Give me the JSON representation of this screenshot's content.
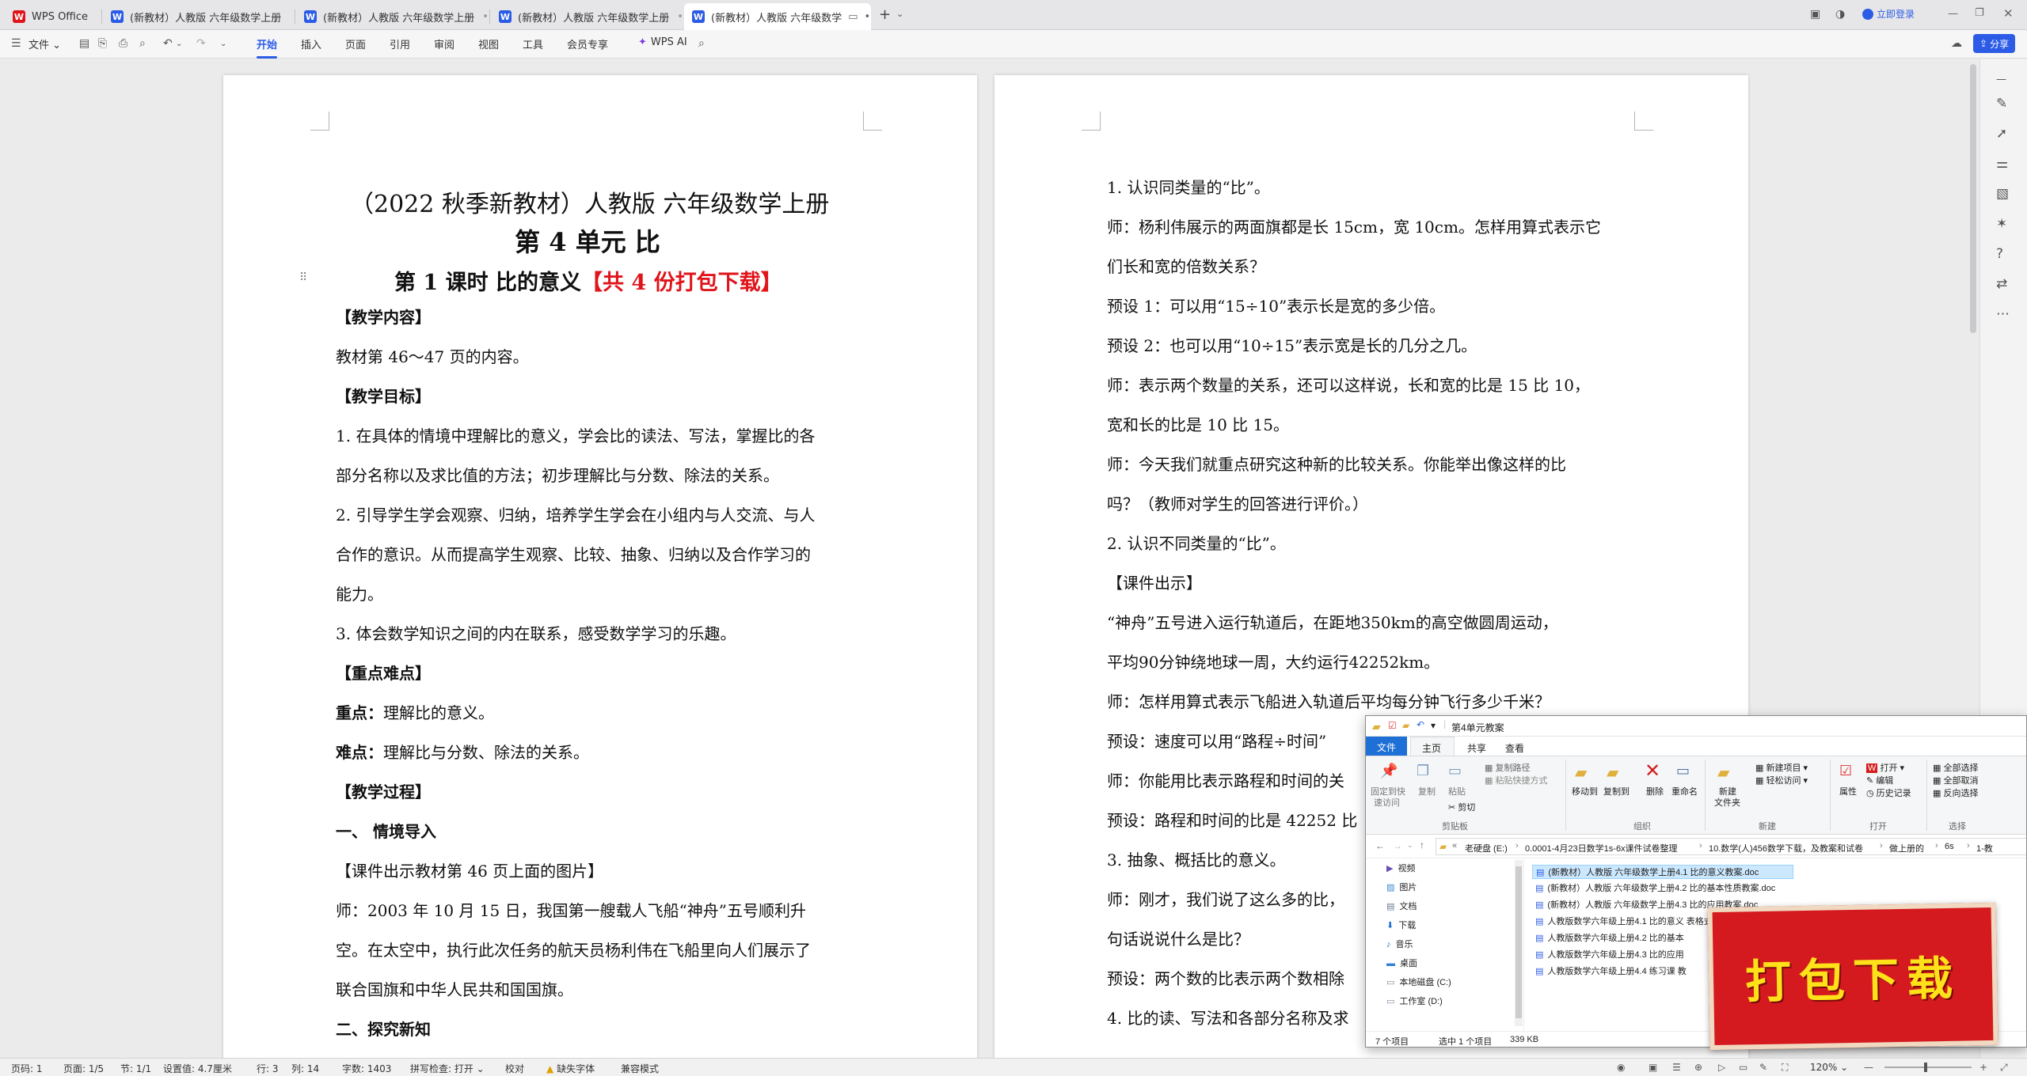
{
  "app": {
    "brand": "WPS Office",
    "accent": "#2c5ce6",
    "brand_color": "#e0141b"
  },
  "tabs": [
    {
      "label": "(新教材）人教版 六年级数学上册"
    },
    {
      "label": "(新教材）人教版 六年级数学上册"
    },
    {
      "label": "(新教材）人教版 六年级数学上册"
    },
    {
      "label": "(新教材）人教版 六年级数学"
    }
  ],
  "titlebar": {
    "login": "立即登录"
  },
  "menu": {
    "file": "文件",
    "items": [
      "开始",
      "插入",
      "页面",
      "引用",
      "审阅",
      "视图",
      "工具",
      "会员专享"
    ],
    "ai": "WPS AI",
    "share": "分享"
  },
  "page1": {
    "title_line1": "（2022 秋季新教材）人教版  六年级数学上册",
    "title_line2": "第 4 单元  比",
    "subtitle": "第 1 课时    比的意义",
    "subtitle_red": "【共 4 份打包下载】",
    "lines": [
      {
        "text": "【教学内容】",
        "bold": true
      },
      {
        "text": "教材第 46～47 页的内容。",
        "bold": false
      },
      {
        "text": "【教学目标】",
        "bold": true
      },
      {
        "text": "1. 在具体的情境中理解比的意义，学会比的读法、写法，掌握比的各",
        "bold": false
      },
      {
        "text": "部分名称以及求比值的方法；初步理解比与分数、除法的关系。",
        "bold": false
      },
      {
        "text": "2. 引导学生学会观察、归纳，培养学生学会在小组内与人交流、与人",
        "bold": false
      },
      {
        "text": "合作的意识。从而提高学生观察、比较、抽象、归纳以及合作学习的",
        "bold": false
      },
      {
        "text": "能力。",
        "bold": false
      },
      {
        "text": "3. 体会数学知识之间的内在联系，感受数学学习的乐趣。",
        "bold": false
      },
      {
        "text": "【重点难点】",
        "bold": true
      },
      {
        "text": "理解比的意义。",
        "bold": false,
        "lead": "重点："
      },
      {
        "text": "理解比与分数、除法的关系。",
        "bold": false,
        "lead": "难点："
      },
      {
        "text": "【教学过程】",
        "bold": true
      },
      {
        "text": "一、  情境导入",
        "bold": true
      },
      {
        "text": "【课件出示教材第 46 页上面的图片】",
        "bold": false
      },
      {
        "text": "师：2003 年 10 月 15 日，我国第一艘载人飞船“神舟”五号顺利升",
        "bold": false
      },
      {
        "text": "空。在太空中，执行此次任务的航天员杨利伟在飞船里向人们展示了",
        "bold": false
      },
      {
        "text": "联合国旗和中华人民共和国国旗。",
        "bold": false
      },
      {
        "text": "二、探究新知",
        "bold": true
      }
    ]
  },
  "page2": {
    "lines": [
      {
        "text": "1. 认识同类量的“比”。",
        "bold": false
      },
      {
        "text": "师：杨利伟展示的两面旗都是长 15cm，宽 10cm。怎样用算式表示它",
        "bold": false
      },
      {
        "text": "们长和宽的倍数关系？",
        "bold": false
      },
      {
        "text": "预设 1：可以用“15÷10”表示长是宽的多少倍。",
        "bold": false
      },
      {
        "text": "预设 2：也可以用“10÷15”表示宽是长的几分之几。",
        "bold": false
      },
      {
        "text": "师：表示两个数量的关系，还可以这样说，长和宽的比是 15 比 10，",
        "bold": false
      },
      {
        "text": "宽和长的比是 10 比 15。",
        "bold": false
      },
      {
        "text": "师：今天我们就重点研究这种新的比较关系。你能举出像这样的比",
        "bold": false
      },
      {
        "text": "吗？（教师对学生的回答进行评价。）",
        "bold": false
      },
      {
        "text": "2. 认识不同类量的“比”。",
        "bold": false
      },
      {
        "text": "【课件出示】",
        "bold": false
      },
      {
        "text": "    “神舟”五号进入运行轨道后，在距地350km的高空做圆周运动，",
        "bold": false
      },
      {
        "text": " 平均90分钟绕地球一周，大约运行42252km。",
        "bold": false
      },
      {
        "text": "师：怎样用算式表示飞船进入轨道后平均每分钟飞行多少千米？",
        "bold": false
      },
      {
        "text": "预设：速度可以用“路程÷时间”",
        "bold": false
      },
      {
        "text": "师：你能用比表示路程和时间的关",
        "bold": false
      },
      {
        "text": "预设：路程和时间的比是 42252 比",
        "bold": false
      },
      {
        "text": "3. 抽象、概括比的意义。",
        "bold": false
      },
      {
        "text": "师：刚才，我们说了这么多的比，",
        "bold": false
      },
      {
        "text": "句话说说什么是比？",
        "bold": false
      },
      {
        "text": "预设：两个数的比表示两个数相除",
        "bold": false
      },
      {
        "text": "4. 比的读、写法和各部分名称及求",
        "bold": false
      }
    ]
  },
  "explorer": {
    "title": "第4单元教案",
    "ribbon_tabs": [
      "文件",
      "主页",
      "共享",
      "查看"
    ],
    "clipboard": {
      "pin": "固定到快",
      "pin2": "速访问",
      "copy": "复制",
      "paste": "粘贴",
      "copy_path": "复制路径",
      "paste_shortcut": "粘贴快捷方式",
      "cut": "剪切",
      "group": "剪贴板"
    },
    "organize": {
      "move": "移动到",
      "copyto": "复制到",
      "delete": "删除",
      "rename": "重命名",
      "group": "组织"
    },
    "new": {
      "folder": "新建",
      "folder2": "文件夹",
      "item": "新建项目",
      "easy": "轻松访问",
      "group": "新建"
    },
    "open": {
      "props": "属性",
      "open": "打开",
      "edit": "编辑",
      "history": "历史记录",
      "group": "打开"
    },
    "select": {
      "all": "全部选择",
      "none": "全部取消",
      "invert": "反向选择",
      "group": "选择"
    },
    "path": [
      "老硬盘 (E:)",
      "0.0001-4月23日数学1s-6x课件试卷整理",
      "10.数学(人)456数学下载，及教案和试卷",
      "做上册的",
      "6s",
      "1-教"
    ],
    "sidebar": [
      "视频",
      "图片",
      "文档",
      "下载",
      "音乐",
      "桌面",
      "本地磁盘 (C:)",
      "工作室 (D:)"
    ],
    "files": [
      "(新教材）人教版 六年级数学上册4.1  比的意义教案.doc",
      "(新教材）人教版 六年级数学上册4.2  比的基本性质教案.doc",
      "(新教材）人教版 六年级数学上册4.3  比的应用教案.doc",
      "人教版数学六年级上册4.1 比的意义 表格式教案.doc",
      "人教版数学六年级上册4.2 比的基本",
      "人教版数学六年级上册4.3 比的应用",
      "人教版数学六年级上册4.4 练习课 教"
    ],
    "status": {
      "count": "7 个项目",
      "selected": "选中 1 个项目",
      "size": "339 KB"
    }
  },
  "stamp": {
    "text": "打包下载"
  },
  "status": {
    "page_no": "页码: 1",
    "pages": "页面: 1/5",
    "section": "节: 1/1",
    "setting": "设置值: 4.7厘米",
    "row": "行: 3",
    "col": "列: 14",
    "words": "字数: 1403",
    "spell": "拼写检查: 打开",
    "proof": "校对",
    "font_missing": "缺失字体",
    "compat": "兼容模式",
    "zoom": "120%"
  }
}
